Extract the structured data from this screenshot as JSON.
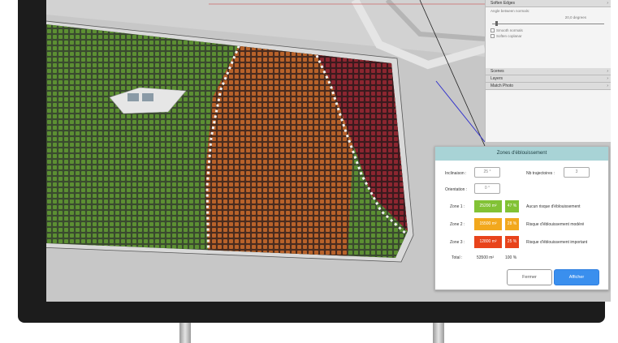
{
  "colors": {
    "green": "#82c235",
    "orange": "#f2a81d",
    "red": "#e8431b",
    "dialog_header": "#a8d3d6",
    "primary_button": "#3a8fee"
  },
  "side_panel": {
    "sections": [
      {
        "label": "Soften Edges"
      },
      {
        "label": "Scenes"
      },
      {
        "label": "Layers"
      },
      {
        "label": "Match Photo"
      }
    ],
    "soften": {
      "normals_label": "Angle between normals:",
      "angle_value": "20,0 degrees",
      "smooth_normals": "Smooth normals",
      "soften_coplanar": "Soften coplanar"
    }
  },
  "dialog": {
    "title": "Zones d'éblouissement",
    "inclination_label": "Inclinaison :",
    "inclination_value": "25 °",
    "orientation_label": "Orientation :",
    "orientation_value": "0 °",
    "trajectories_label": "Nb trajectoires :",
    "trajectories_value": "3",
    "zones": [
      {
        "label": "Zone 1 :",
        "area": "25200 m²",
        "percent": "47 %",
        "description": "Aucun risque d'éblouissement"
      },
      {
        "label": "Zone 2 :",
        "area": "15500 m²",
        "percent": "28 %",
        "description": "Risque d'éblouissement modéré"
      },
      {
        "label": "Zone 3 :",
        "area": "12800 m²",
        "percent": "25 %",
        "description": "Risque d'éblouissement important"
      }
    ],
    "total_label": "Total :",
    "total_area": "53500 m²",
    "total_percent": "100 %",
    "close_label": "Fermer",
    "show_label": "Afficher"
  }
}
